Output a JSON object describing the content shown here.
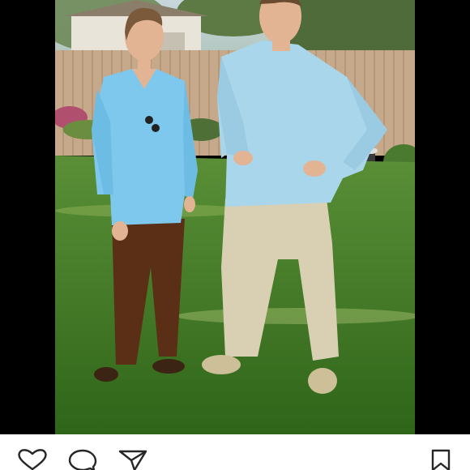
{
  "post": {
    "photo": {
      "description_icon": "photo",
      "colors": {
        "sky": "#b9cfd8",
        "fence": "#c9ad90",
        "grass": "#3f7a25",
        "shirt": "#7ec8ee",
        "shirt_light": "#a9d6ea",
        "brown_pants": "#5a2f16",
        "khaki": "#d9d0b4",
        "skin": "#e3b493"
      }
    },
    "actions": {
      "like_icon": "heart-icon",
      "comment_icon": "comment-icon",
      "share_icon": "send-icon",
      "save_icon": "bookmark-icon"
    }
  }
}
